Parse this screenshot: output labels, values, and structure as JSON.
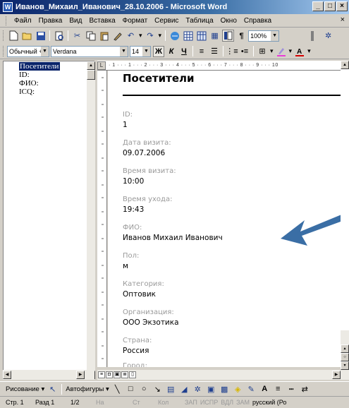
{
  "window": {
    "title": "Иванов_Михаил_Иванович_28.10.2006 - Microsoft Word",
    "app_icon": "W",
    "buttons": [
      "_",
      "□",
      "×"
    ]
  },
  "menu": {
    "items": [
      "Файл",
      "Правка",
      "Вид",
      "Вставка",
      "Формат",
      "Сервис",
      "Таблица",
      "Окно",
      "Справка"
    ],
    "close": "×"
  },
  "toolbar": {
    "zoom": "100%",
    "style": "Обычный + Verc",
    "font": "Verdana",
    "size": "14",
    "bold": "Ж",
    "italic": "К",
    "underline": "Ч",
    "pilcrow": "¶"
  },
  "docmap": {
    "items": [
      "Посетители",
      "ID:",
      "ФИО:",
      "ICQ:"
    ]
  },
  "ruler": {
    "marks": "· 1 · · · 1 · · · 2 · · · 3 · · · 4 · · · 5 · · · 6 · · · 7 · · · 8 · · · 9 · · · 10"
  },
  "document": {
    "title": "Посетители",
    "fields": [
      {
        "label": "ID:",
        "value": "1"
      },
      {
        "label": "Дата визита:",
        "value": "09.07.2006"
      },
      {
        "label": "Время визита:",
        "value": "10:00"
      },
      {
        "label": "Время ухода:",
        "value": "19:43"
      },
      {
        "label": "ФИО:",
        "value": "Иванов Михаил Иванович"
      },
      {
        "label": "Пол:",
        "value": "м"
      },
      {
        "label": "Категория:",
        "value": "Оптовик"
      },
      {
        "label": "Организация:",
        "value": "ООО Экзотика"
      },
      {
        "label": "Страна:",
        "value": "Россия"
      },
      {
        "label": "Город:",
        "value": ""
      }
    ]
  },
  "drawbar": {
    "drawing": "Рисование ▾",
    "autoshapes": "Автофигуры ▾"
  },
  "status": {
    "page": "Стр. 1",
    "section": "Разд 1",
    "pages": "1/2",
    "at": "На",
    "line": "Ст",
    "col": "Кол",
    "rec": "ЗАП",
    "trk": "ИСПР",
    "ext": "ВДЛ",
    "ovr": "ЗАМ",
    "lang": "русский (Ро"
  },
  "colors": {
    "titlebar": "#0a246a",
    "arrow": "#3a6ea5",
    "selection": "#0a246a"
  }
}
